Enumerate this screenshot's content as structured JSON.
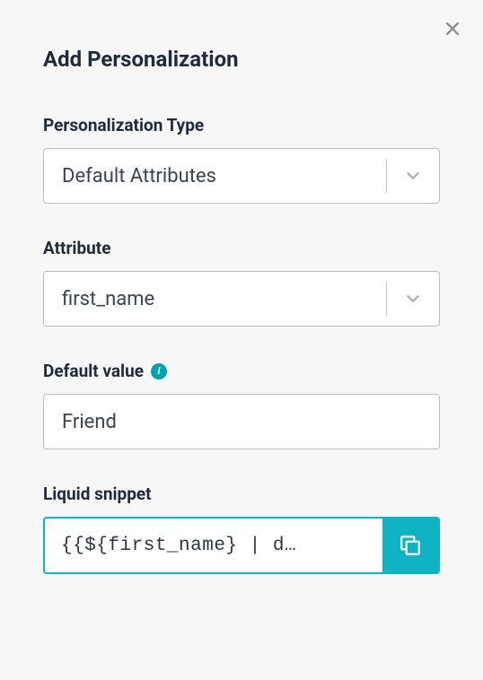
{
  "modal": {
    "title": "Add Personalization"
  },
  "fields": {
    "type": {
      "label": "Personalization Type",
      "value": "Default Attributes"
    },
    "attribute": {
      "label": "Attribute",
      "value": "first_name"
    },
    "default_value": {
      "label": "Default value",
      "value": "Friend"
    },
    "snippet": {
      "label": "Liquid snippet",
      "value": "{{${first_name} | d…"
    }
  }
}
